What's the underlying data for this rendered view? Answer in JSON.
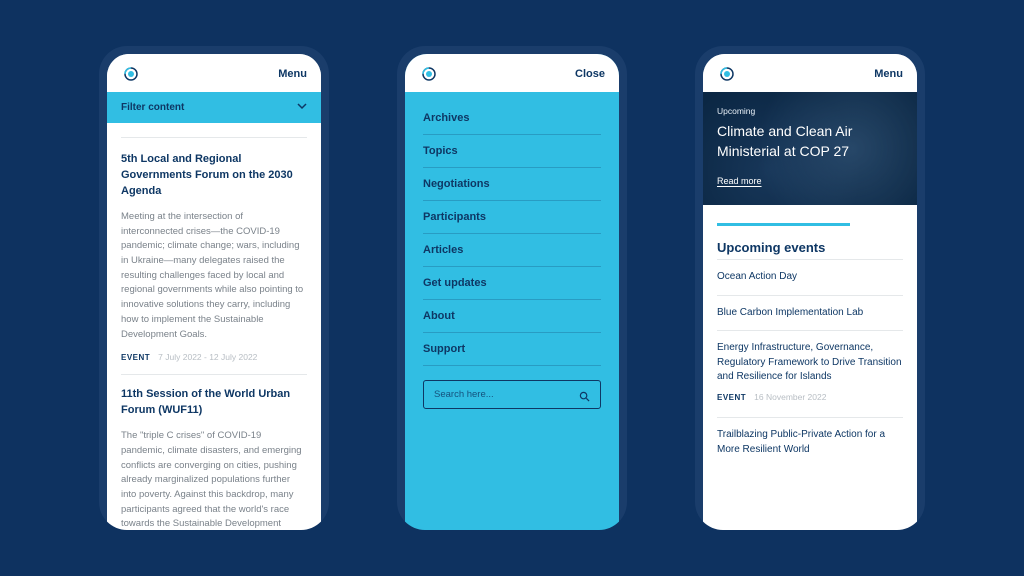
{
  "header": {
    "menu_label": "Menu",
    "close_label": "Close"
  },
  "phone1": {
    "filter_label": "Filter content",
    "articles": [
      {
        "title": "5th Local and Regional Governments Forum on the 2030 Agenda",
        "body": "Meeting at the intersection of interconnected crises—the COVID-19 pandemic; climate change; wars, including in Ukraine—many delegates raised the resulting challenges faced by local and regional governments while also pointing to innovative solutions they carry, including how to implement the Sustainable Development Goals.",
        "tag": "EVENT",
        "date": "7 July 2022 - 12 July 2022"
      },
      {
        "title": "11th Session of the World Urban Forum (WUF11)",
        "body": "The \"triple C crises\" of COVID-19 pandemic, climate disasters, and emerging conflicts are converging on cities, pushing already marginalized populations further into poverty. Against this backdrop, many participants agreed that the world's race towards the Sustainable Development Goals (SDGs) will be decided in cities, and it will be decided soon."
      }
    ]
  },
  "phone2": {
    "menu_items": [
      "Archives",
      "Topics",
      "Negotiations",
      "Participants",
      "Articles",
      "Get updates",
      "About",
      "Support"
    ],
    "search_placeholder": "Search here..."
  },
  "phone3": {
    "hero": {
      "eyebrow": "Upcoming",
      "title": "Climate and Clean Air Ministerial at COP 27",
      "readmore": "Read more"
    },
    "section_title": "Upcoming events",
    "events": [
      {
        "title": "Ocean Action Day"
      },
      {
        "title": "Blue Carbon Implementation Lab"
      },
      {
        "title": "Energy Infrastructure, Governance, Regulatory Framework to Drive Transition and Resilience for Islands",
        "tag": "EVENT",
        "date": "16 November 2022"
      },
      {
        "title": "Trailblazing Public-Private Action for a More Resilient World"
      }
    ]
  }
}
